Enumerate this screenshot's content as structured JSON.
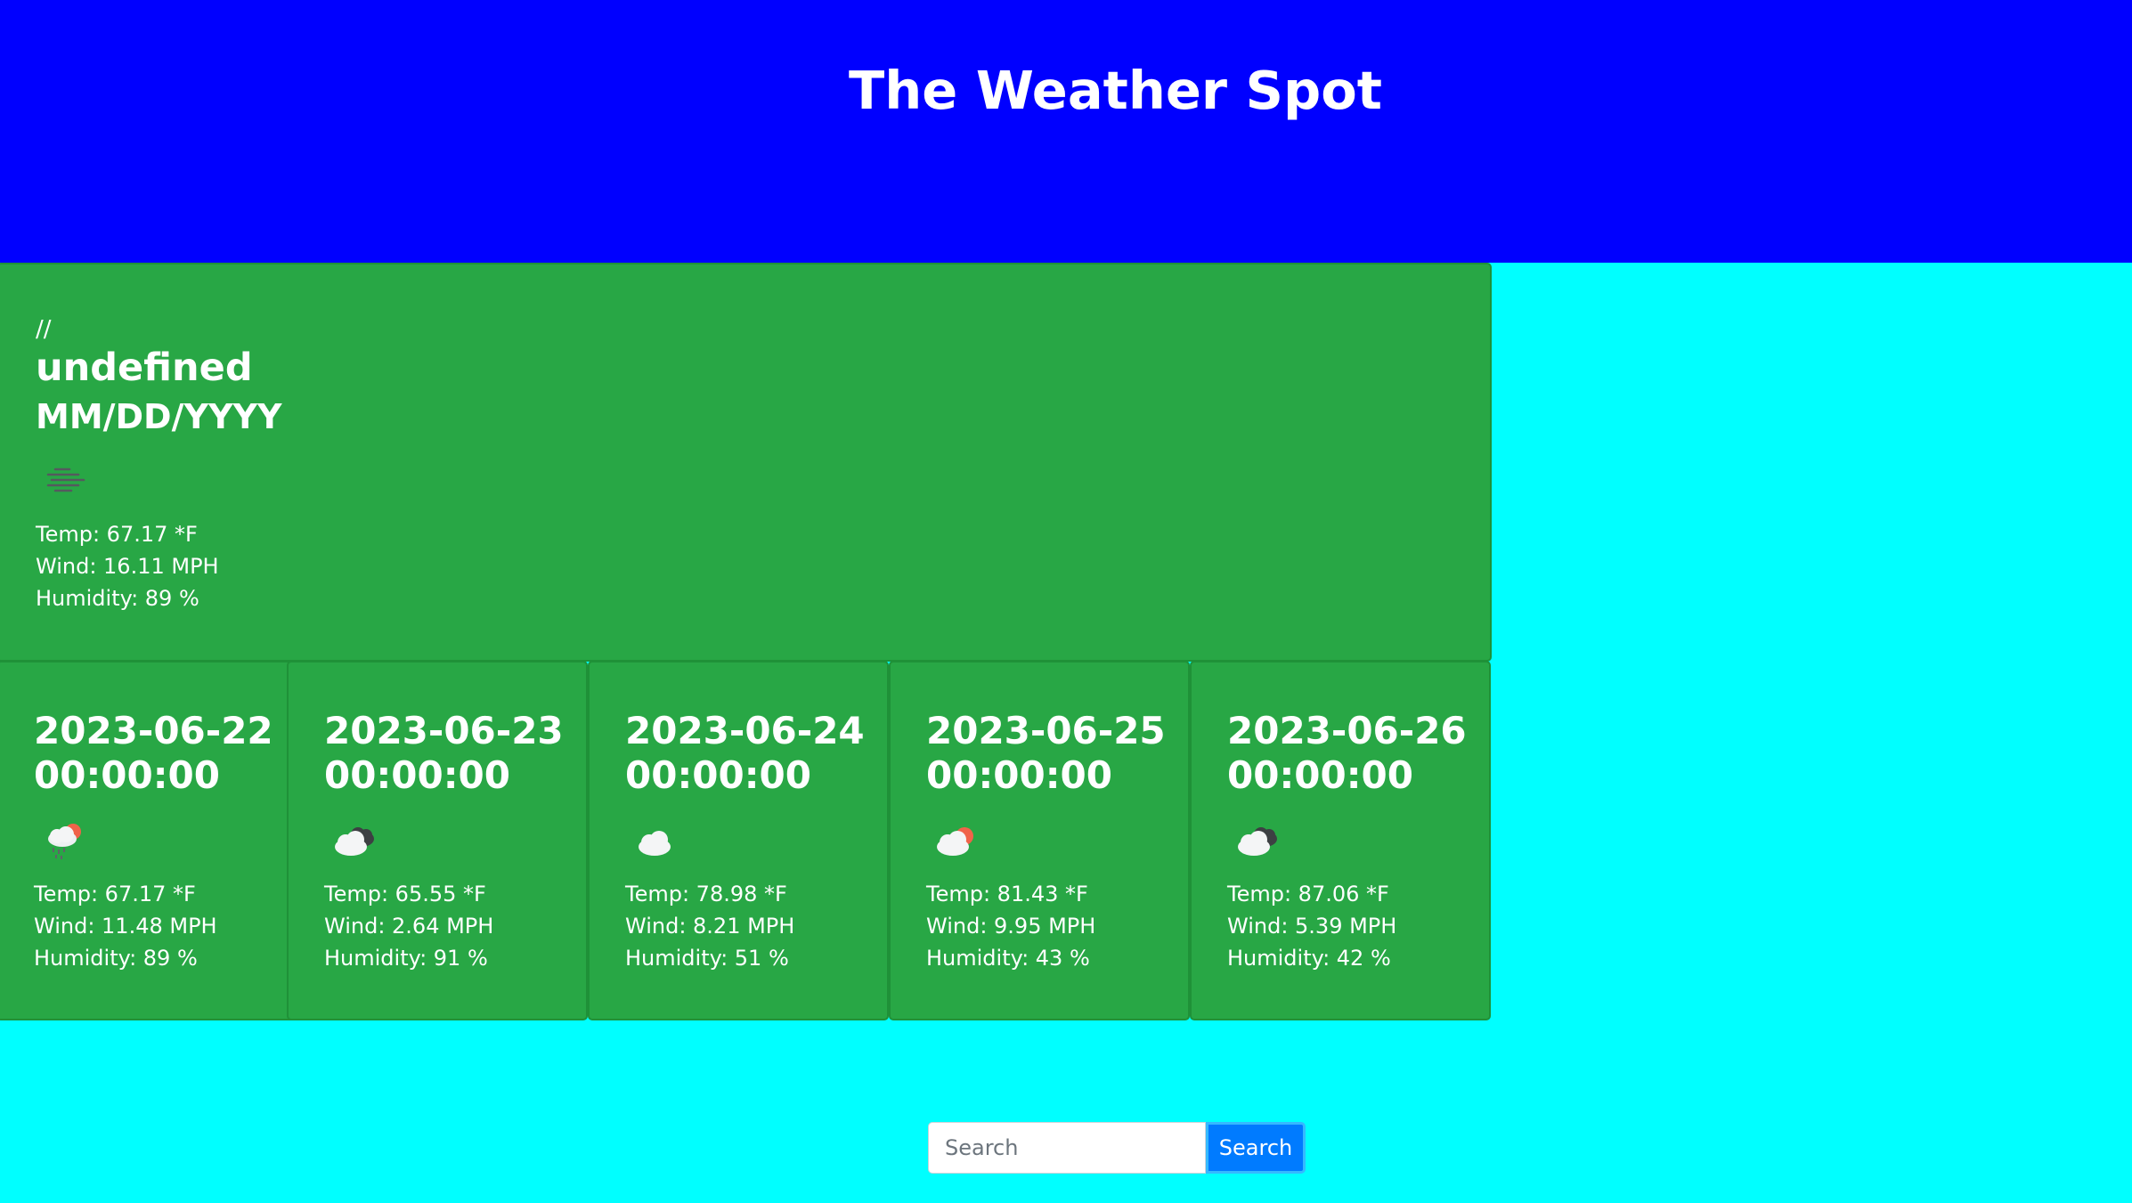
{
  "header": {
    "title": "The Weather Spot"
  },
  "current": {
    "slashes": "//",
    "city": "undefined",
    "date": "MM/DD/YYYY",
    "icon": "mist-icon",
    "temp": "Temp: 67.17 *F",
    "wind": "Wind: 16.11 MPH",
    "humidity": "Humidity: 89 %"
  },
  "forecast": [
    {
      "date": "2023-06-22 00:00:00",
      "icon": "sun-rain-cloud-icon",
      "temp": "Temp: 67.17 *F",
      "wind": "Wind: 11.48 MPH",
      "humidity": "Humidity: 89 %"
    },
    {
      "date": "2023-06-23 00:00:00",
      "icon": "broken-clouds-icon",
      "temp": "Temp: 65.55 *F",
      "wind": "Wind: 2.64 MPH",
      "humidity": "Humidity: 91 %"
    },
    {
      "date": "2023-06-24 00:00:00",
      "icon": "cloud-icon",
      "temp": "Temp: 78.98 *F",
      "wind": "Wind: 8.21 MPH",
      "humidity": "Humidity: 51 %"
    },
    {
      "date": "2023-06-25 00:00:00",
      "icon": "sun-cloud-icon",
      "temp": "Temp: 81.43 *F",
      "wind": "Wind: 9.95 MPH",
      "humidity": "Humidity: 43 %"
    },
    {
      "date": "2023-06-26 00:00:00",
      "icon": "broken-clouds-icon",
      "temp": "Temp: 87.06 *F",
      "wind": "Wind: 5.39 MPH",
      "humidity": "Humidity: 42 %"
    }
  ],
  "search": {
    "placeholder": "Search",
    "value": "",
    "button_label": "Search"
  },
  "colors": {
    "header_bg": "#0000ff",
    "page_bg": "#00ffff",
    "card_bg": "#28a745",
    "button_bg": "#007bff"
  }
}
